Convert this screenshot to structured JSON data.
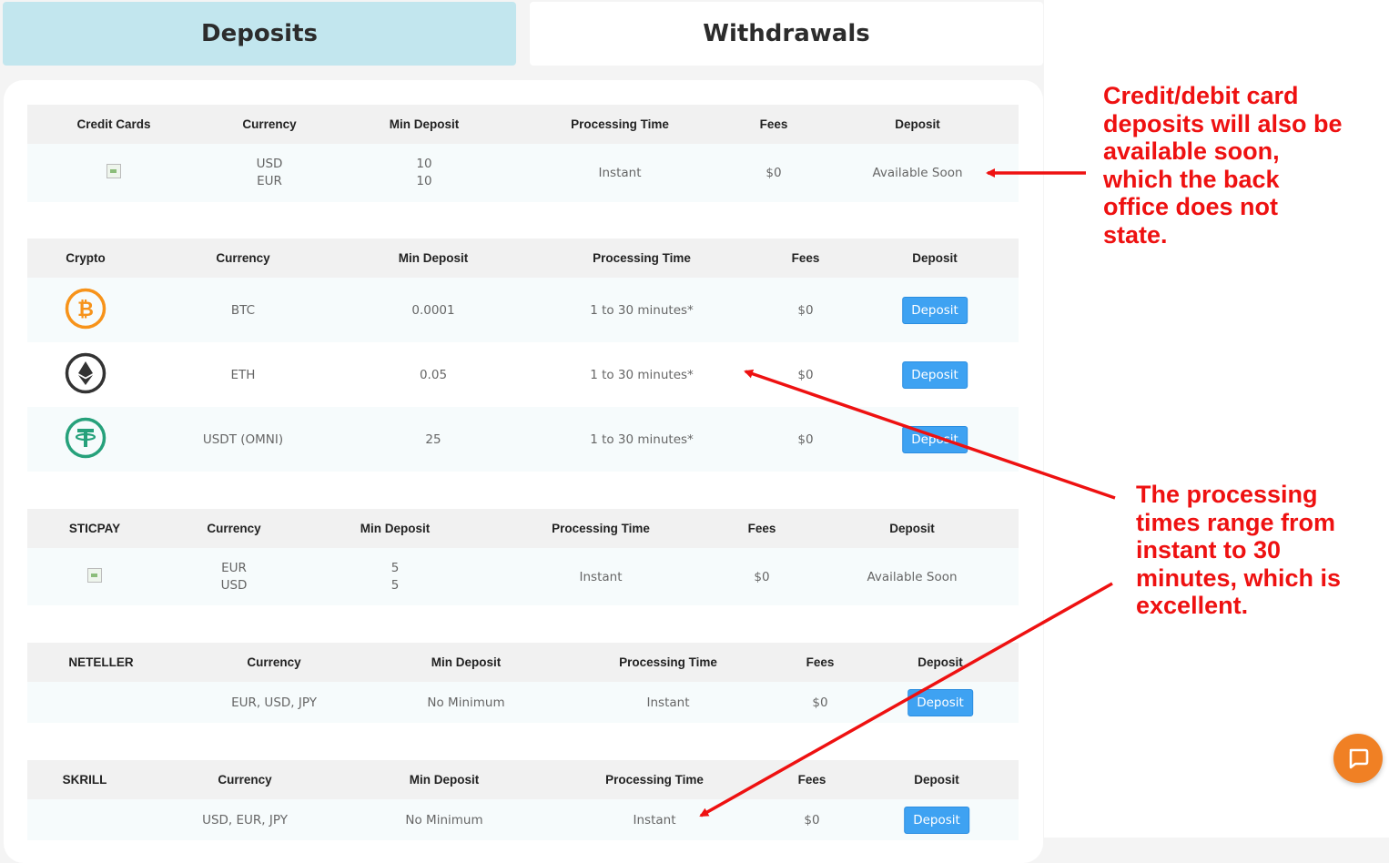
{
  "tabs": {
    "deposits": "Deposits",
    "withdrawals": "Withdrawals"
  },
  "headers": {
    "currency": "Currency",
    "min_deposit": "Min Deposit",
    "processing_time": "Processing Time",
    "fees": "Fees",
    "deposit": "Deposit"
  },
  "credit_cards": {
    "title": "Credit Cards",
    "currencies": [
      "USD",
      "EUR"
    ],
    "mins": [
      "10",
      "10"
    ],
    "time": "Instant",
    "fee": "$0",
    "status": "Available Soon"
  },
  "crypto": {
    "title": "Crypto",
    "rows": [
      {
        "icon": "bitcoin-icon",
        "currency": "BTC",
        "min": "0.0001",
        "time": "1 to 30 minutes*",
        "fee": "$0",
        "button": "Deposit"
      },
      {
        "icon": "ethereum-icon",
        "currency": "ETH",
        "min": "0.05",
        "time": "1 to 30 minutes*",
        "fee": "$0",
        "button": "Deposit"
      },
      {
        "icon": "tether-icon",
        "currency": "USDT (OMNI)",
        "min": "25",
        "time": "1 to 30 minutes*",
        "fee": "$0",
        "button": "Deposit"
      }
    ]
  },
  "sticpay": {
    "title": "STICPAY",
    "currencies": [
      "EUR",
      "USD"
    ],
    "mins": [
      "5",
      "5"
    ],
    "time": "Instant",
    "fee": "$0",
    "status": "Available Soon"
  },
  "neteller": {
    "title": "NETELLER",
    "currency": "EUR, USD, JPY",
    "min": "No Minimum",
    "time": "Instant",
    "fee": "$0",
    "button": "Deposit"
  },
  "skrill": {
    "title": "SKRILL",
    "currency": "USD, EUR, JPY",
    "min": "No Minimum",
    "time": "Instant",
    "fee": "$0",
    "button": "Deposit"
  },
  "annotations": {
    "note1": [
      "Credit/debit card",
      "deposits will also be",
      "available soon,",
      "which the back",
      "office does not",
      "state."
    ],
    "note2": [
      "The processing",
      "times range from",
      "instant to 30",
      "minutes, which is",
      "excellent."
    ]
  },
  "colors": {
    "active_tab": "#c2e6ee",
    "button": "#3ea2f2",
    "annotation": "#ee1111",
    "chat": "#f08024"
  }
}
